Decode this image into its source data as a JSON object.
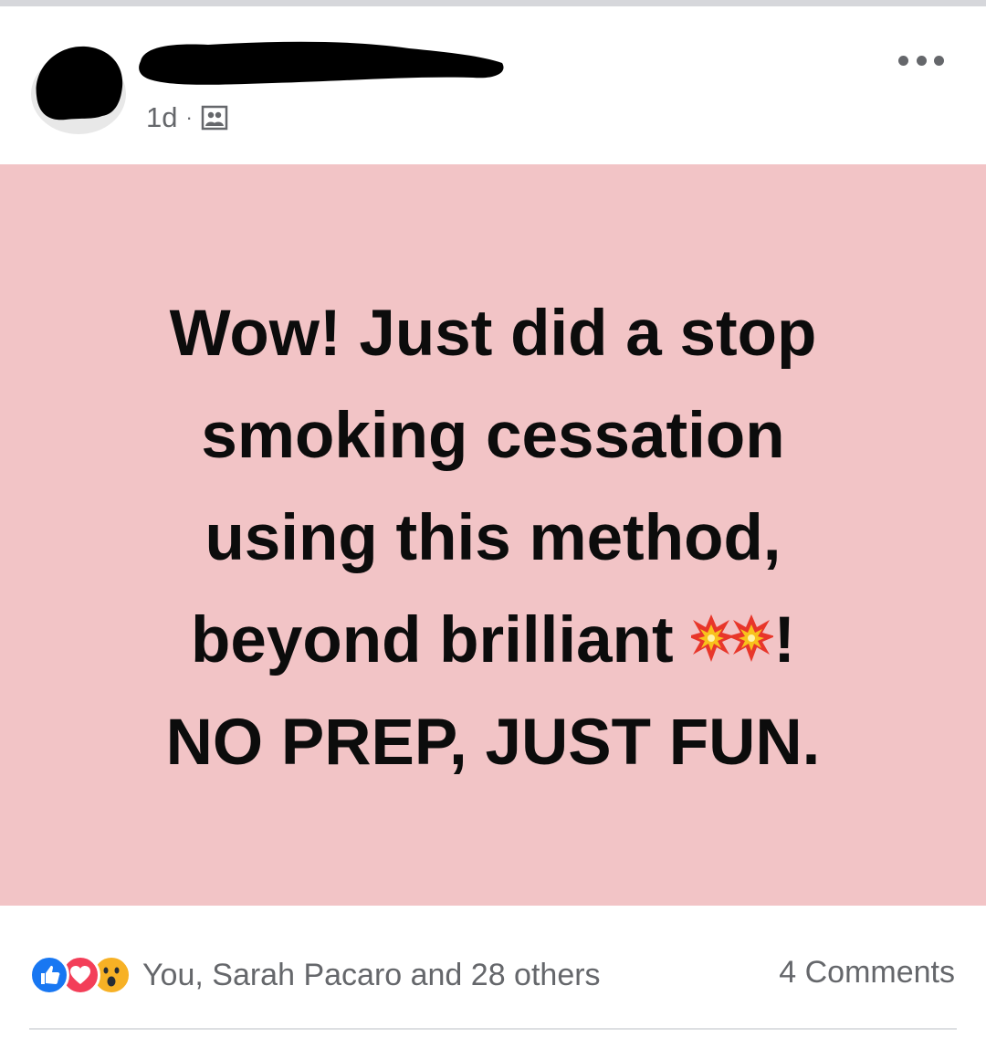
{
  "colors": {
    "post_background": "#f2c4c6",
    "secondary_text": "#65676b",
    "post_text": "#0c0c0c",
    "like_blue": "#1877f2",
    "love_red": "#f33e58",
    "wow_yellow": "#f7b125"
  },
  "header": {
    "author_name": "",
    "timestamp": "1d",
    "separator": "·",
    "audience_icon": "group-icon",
    "more_icon": "more-options-icon"
  },
  "post": {
    "lines": [
      "Wow! Just did a stop",
      "smoking cessation",
      "using this method,",
      "beyond brilliant",
      "!",
      "NO PREP, JUST FUN."
    ],
    "emoji_icon": "collision-burst-icon"
  },
  "footer": {
    "reaction_icons": [
      "like-icon",
      "love-icon",
      "wow-icon"
    ],
    "reaction_summary": "You, Sarah Pacaro and 28 others",
    "comments": "4 Comments"
  }
}
